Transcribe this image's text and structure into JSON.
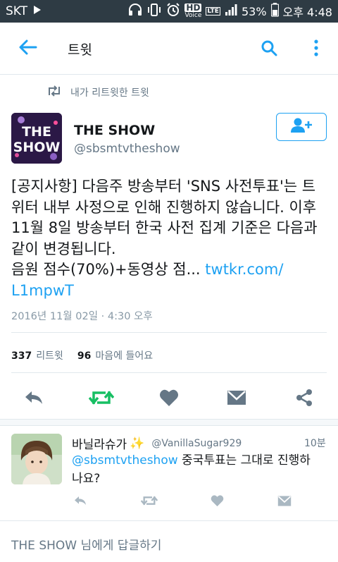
{
  "status_bar": {
    "carrier": "SKT",
    "hd": "HD",
    "voice": "Voice",
    "lte": "LTE",
    "battery": "53%",
    "time": "오후 4:48"
  },
  "app_bar": {
    "title": "트윗",
    "icons": [
      "back-arrow-icon",
      "search-icon",
      "more-vert-icon"
    ]
  },
  "retweet_context": {
    "label": "내가 리트윗한 트윗"
  },
  "tweet": {
    "author_name": "THE SHOW",
    "author_handle": "@sbsmtvtheshow",
    "avatar_text_1": "THE",
    "avatar_text_2": "SHOW",
    "text": "[공지사항] 다음주 방송부터 'SNS 사전투표'는 트위터 내부 사정으로 인해 진행하지 않습니다. 이후 11월 8일 방송부터 한국 사전 집계 기준은 다음과 같이 변경됩니다.\n음원 점수(70%)+동영상 점... ",
    "link": "twtkr.com/\nL1mpwT",
    "timestamp": "2016년 11월 02일 · 4:30 오후",
    "retweets_count": "337",
    "retweets_label": "리트윗",
    "likes_count": "96",
    "likes_label": "마음에 들어요"
  },
  "reply": {
    "name": "바닐라슈가",
    "name_emoji": "✨",
    "handle": "@VanillaSugar929",
    "time": "10분",
    "mention": "@sbsmtvtheshow",
    "text": " 중국투표는 그대로 진행하나요?"
  },
  "compose": {
    "placeholder": "THE SHOW 님에게 답글하기"
  },
  "colors": {
    "accent": "#1da1f2",
    "retweet_green": "#17bf63",
    "icon_grey": "#657786",
    "status_bar": "#2e3b44"
  }
}
